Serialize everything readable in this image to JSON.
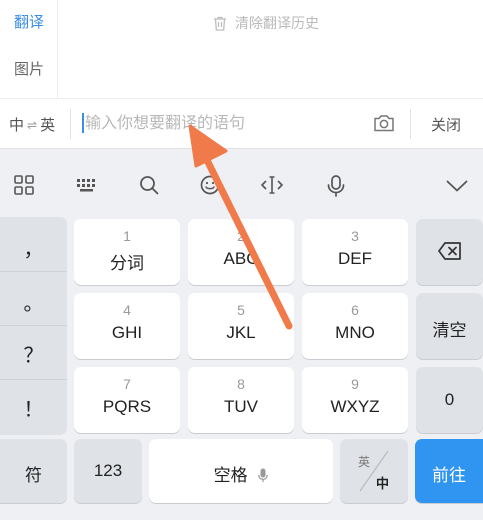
{
  "sidebar": {
    "items": [
      {
        "label": "翻译"
      },
      {
        "label": "图片"
      }
    ]
  },
  "history": {
    "clear_label": "清除翻译历史"
  },
  "input_row": {
    "source_lang": "中",
    "swap_symbol": "⇌",
    "target_lang": "英",
    "placeholder": "输入你想要翻译的语句",
    "close_label": "关闭"
  },
  "keyboard": {
    "toolbar_icons": [
      "grid-icon",
      "keyboard-icon",
      "search-icon",
      "emoji-icon",
      "cursor-move-icon",
      "microphone-icon",
      "chevron-down-icon"
    ],
    "punctuation": [
      "，",
      "。",
      "？",
      "！"
    ],
    "keys": [
      {
        "num": "1",
        "label": "分词"
      },
      {
        "num": "2",
        "label": "ABC"
      },
      {
        "num": "3",
        "label": "DEF"
      },
      {
        "num": "4",
        "label": "GHI"
      },
      {
        "num": "5",
        "label": "JKL"
      },
      {
        "num": "6",
        "label": "MNO"
      },
      {
        "num": "7",
        "label": "PQRS"
      },
      {
        "num": "8",
        "label": "TUV"
      },
      {
        "num": "9",
        "label": "WXYZ"
      }
    ],
    "clear_label": "清空",
    "zero_label": "0",
    "symbol_label": "符",
    "numbers_label": "123",
    "space_label": "空格",
    "lang_toggle": {
      "top": "英",
      "bottom": "中"
    },
    "go_label": "前往"
  },
  "colors": {
    "accent": "#2f95f0",
    "arrow": "#f07a4a"
  }
}
